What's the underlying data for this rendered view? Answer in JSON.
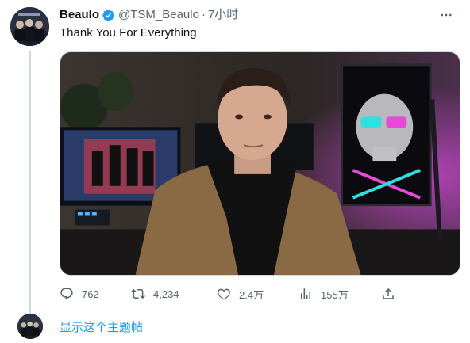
{
  "tweet": {
    "display_name": "Beaulo",
    "handle": "@TSM_Beaulo",
    "separator": "·",
    "time": "7小时",
    "text": "Thank You For Everything",
    "verified": true
  },
  "actions": {
    "replies": "762",
    "retweets": "4,234",
    "likes": "2.4万",
    "views": "155万"
  },
  "thread": {
    "show_label": "显示这个主题帖"
  },
  "colors": {
    "accent": "#1d9bf0",
    "secondary_text": "#536471",
    "primary_text": "#0f1419",
    "thread_line": "#cfd9de"
  },
  "icons": [
    "verified-badge-icon",
    "more-icon",
    "reply-icon",
    "retweet-icon",
    "like-icon",
    "views-icon",
    "share-icon"
  ]
}
